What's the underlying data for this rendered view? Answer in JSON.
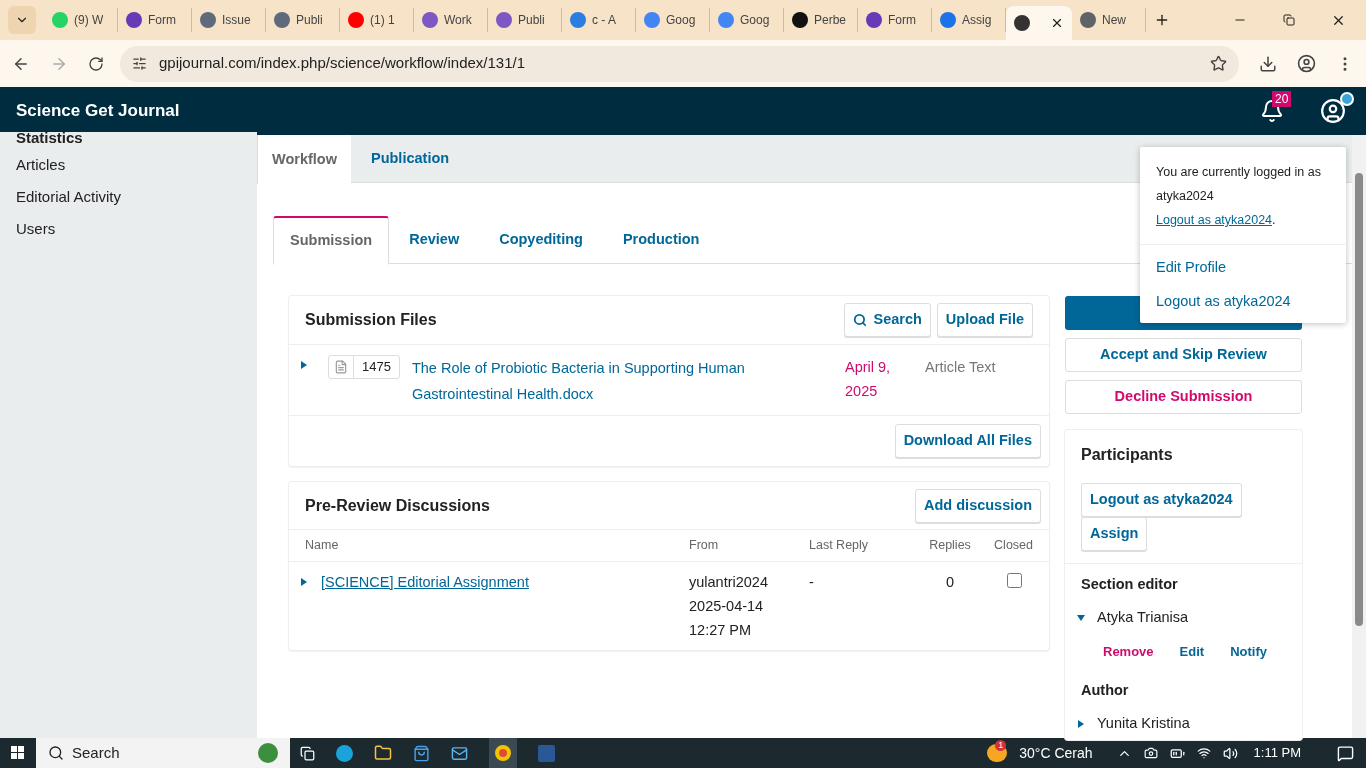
{
  "browser": {
    "tabs": [
      {
        "title": "(9) W",
        "selected": false,
        "color": "#25d366"
      },
      {
        "title": "Form",
        "selected": false,
        "color": "#673ab7"
      },
      {
        "title": "Issue",
        "selected": false,
        "color": "#5f6b7a"
      },
      {
        "title": "Publi",
        "selected": false,
        "color": "#5f6b7a"
      },
      {
        "title": "(1) 1",
        "selected": false,
        "color": "#ff0000"
      },
      {
        "title": "Work",
        "selected": false,
        "color": "#7e57c2"
      },
      {
        "title": "Publi",
        "selected": false,
        "color": "#7e57c2"
      },
      {
        "title": "c - A",
        "selected": false,
        "color": "#2a7de1"
      },
      {
        "title": "Goog",
        "selected": false,
        "color": "#4285f4"
      },
      {
        "title": "Goog",
        "selected": false,
        "color": "#4285f4"
      },
      {
        "title": "Perbe",
        "selected": false,
        "color": "#111111"
      },
      {
        "title": "Form",
        "selected": false,
        "color": "#673ab7"
      },
      {
        "title": "Assig",
        "selected": false,
        "color": "#1a73e8"
      },
      {
        "selected": true,
        "color": "#333333"
      },
      {
        "title": "New",
        "selected": false,
        "color": "#5f6368"
      }
    ],
    "url": "gpijournal.com/index.php/science/workflow/index/131/1"
  },
  "app": {
    "title": "Science Get Journal",
    "notifications": "20"
  },
  "sidebar": {
    "items": [
      {
        "label": "Statistics",
        "kind": "heading"
      },
      {
        "label": "Articles",
        "kind": "link"
      },
      {
        "label": "Editorial Activity",
        "kind": "link"
      },
      {
        "label": "Users",
        "kind": "link"
      }
    ]
  },
  "page_tabs": [
    {
      "label": "Workflow",
      "selected": true
    },
    {
      "label": "Publication",
      "selected": false
    }
  ],
  "stage_tabs": [
    {
      "label": "Submission",
      "selected": true
    },
    {
      "label": "Review",
      "selected": false
    },
    {
      "label": "Copyediting",
      "selected": false
    },
    {
      "label": "Production",
      "selected": false
    }
  ],
  "submission_files": {
    "title": "Submission Files",
    "search": "Search",
    "upload": "Upload File",
    "files": [
      {
        "id": "1475",
        "name": "The Role of Probiotic Bacteria in Supporting Human Gastrointestinal Health.docx",
        "date": "April 9, 2025",
        "type": "Article Text",
        "expanded": false
      }
    ],
    "download_all": "Download All Files"
  },
  "discussions": {
    "title": "Pre-Review Discussions",
    "add": "Add discussion",
    "columns": [
      "Name",
      "From",
      "Last Reply",
      "Replies",
      "Closed"
    ],
    "rows": [
      {
        "name": "[SCIENCE] Editorial Assignment",
        "from": [
          "yulantri2024",
          "2025-04-14",
          "12:27 PM"
        ],
        "last_reply": "-",
        "replies": "0",
        "closed": false,
        "expanded": false
      }
    ]
  },
  "actions": [
    {
      "kind": "primary"
    },
    {
      "kind": "default",
      "label": "Accept and Skip Review"
    },
    {
      "kind": "danger",
      "label": "Decline Submission"
    }
  ],
  "participants": {
    "title": "Participants",
    "buttons": [
      "Logout as atyka2024",
      "Assign"
    ],
    "groups": [
      {
        "role": "Section editor",
        "people": [
          {
            "name": "Atyka Trianisa",
            "expanded": true,
            "actions": [
              {
                "label": "Remove",
                "kind": "danger"
              },
              {
                "label": "Edit",
                "kind": "default"
              },
              {
                "label": "Notify",
                "kind": "default"
              }
            ]
          }
        ]
      },
      {
        "role": "Author",
        "people": [
          {
            "name": "Yunita Kristina",
            "expanded": false
          }
        ]
      }
    ]
  },
  "user_menu": {
    "message": "You are currently logged in as atyka2024",
    "link": "Logout as atyka2024",
    "end": ".",
    "items": [
      "Edit Profile",
      "Logout as atyka2024"
    ]
  },
  "taskbar": {
    "search": "Search",
    "weather_badge": "1",
    "weather": "30°C Cerah",
    "time": "1:11 PM"
  }
}
